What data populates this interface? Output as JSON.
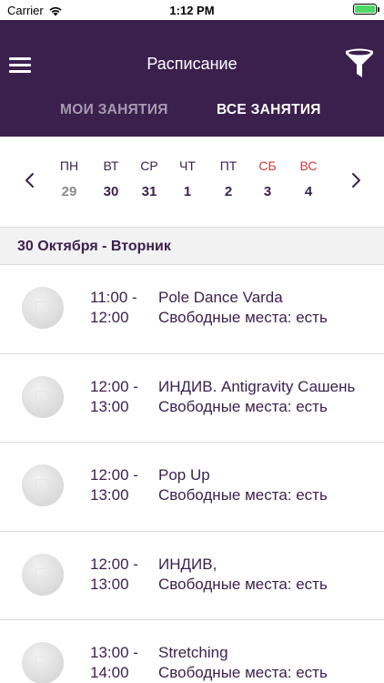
{
  "status_bar": {
    "carrier": "Carrier",
    "time": "1:12 PM"
  },
  "header": {
    "title": "Расписание"
  },
  "tabs": [
    {
      "label": "МОИ ЗАНЯТИЯ",
      "active": false
    },
    {
      "label": "ВСЕ ЗАНЯТИЯ",
      "active": true
    }
  ],
  "week": {
    "days": [
      {
        "name": "ПН",
        "date": "29"
      },
      {
        "name": "ВТ",
        "date": "30"
      },
      {
        "name": "СР",
        "date": "31"
      },
      {
        "name": "ЧТ",
        "date": "1"
      },
      {
        "name": "ПТ",
        "date": "2"
      },
      {
        "name": "СБ",
        "date": "3"
      },
      {
        "name": "ВС",
        "date": "4"
      }
    ]
  },
  "date_header": "30 Октября - Вторник",
  "classes": [
    {
      "start": "11:00 -",
      "end": "12:00",
      "name": "Pole Dance Varda",
      "seats": "Свободные места: есть"
    },
    {
      "start": "12:00 -",
      "end": "13:00",
      "name": "ИНДИВ. Antigravity Сашень",
      "seats": "Свободные места: есть"
    },
    {
      "start": "12:00 -",
      "end": "13:00",
      "name": "Pop Up",
      "seats": "Свободные места: есть"
    },
    {
      "start": "12:00 -",
      "end": "13:00",
      "name": "ИНДИВ,",
      "seats": "Свободные места: есть"
    },
    {
      "start": "13:00 -",
      "end": "14:00",
      "name": "Stretching",
      "seats": "Свободные места: есть"
    }
  ],
  "colors": {
    "brand": "#3b1f4d",
    "weekend": "#d1393a",
    "battery": "#4cd964"
  }
}
